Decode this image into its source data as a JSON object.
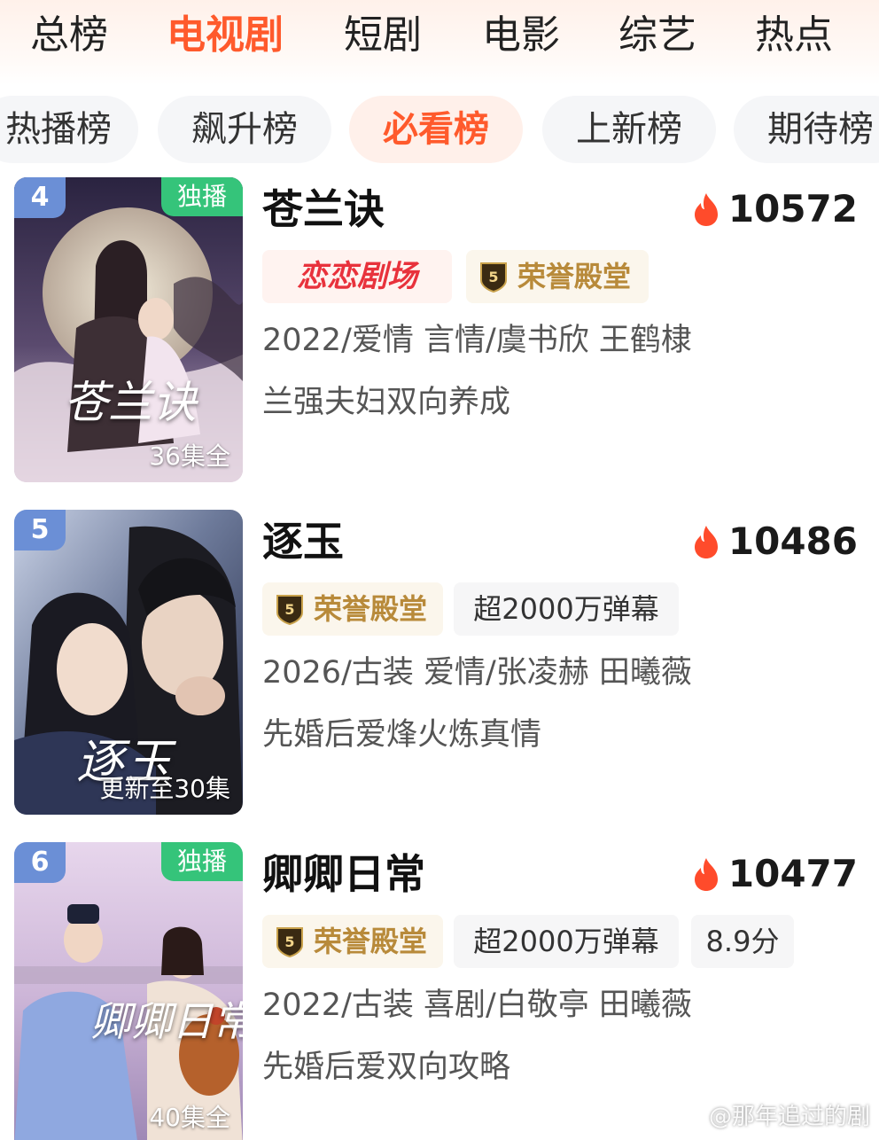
{
  "top_tabs": [
    "总榜",
    "电视剧",
    "短剧",
    "电影",
    "综艺",
    "热点"
  ],
  "active_top_tab": "电视剧",
  "sub_tabs": [
    "热播榜",
    "飙升榜",
    "必看榜",
    "上新榜",
    "期待榜"
  ],
  "active_sub_tab": "必看榜",
  "colors": {
    "accent": "#ff5a2c",
    "exclusive_badge": "#35c47a",
    "honor_gold": "#b88a3a",
    "theater_red": "#e8323c"
  },
  "items": [
    {
      "rank": "4",
      "exclusive_label": "独播",
      "poster_title": "苍兰诀",
      "episodes": "36集全",
      "title": "苍兰诀",
      "heat": "10572",
      "tags": [
        "恋恋剧场",
        "荣誉殿堂"
      ],
      "meta": "2022/爱情 言情/虞书欣 王鹤棣",
      "desc": "兰强夫妇双向养成"
    },
    {
      "rank": "5",
      "poster_title": "逐玉",
      "episodes": "更新至30集",
      "title": "逐玉",
      "heat": "10486",
      "tags": [
        "荣誉殿堂",
        "超2000万弹幕"
      ],
      "meta": "2026/古装 爱情/张凌赫 田曦薇",
      "desc": "先婚后爱烽火炼真情"
    },
    {
      "rank": "6",
      "exclusive_label": "独播",
      "poster_title": "卿卿日常",
      "episodes": "40集全",
      "title": "卿卿日常",
      "heat": "10477",
      "tags": [
        "荣誉殿堂",
        "超2000万弹幕",
        "8.9分"
      ],
      "meta": "2022/古装 喜剧/白敬亭 田曦薇",
      "desc": "先婚后爱双向攻略"
    }
  ],
  "icons": {
    "heat": "flame-icon",
    "honor": "medal-5-icon",
    "weibo": "weibo-icon"
  },
  "watermark": "@那年追过的剧"
}
